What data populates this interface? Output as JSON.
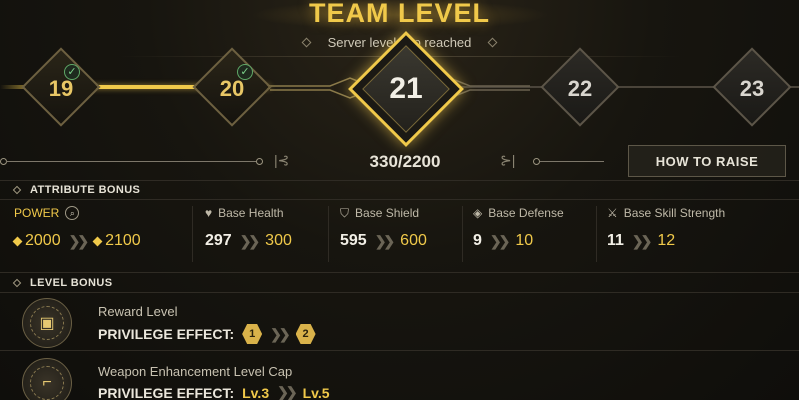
{
  "header": {
    "title": "TEAM LEVEL",
    "subtitle": "Server level cap reached"
  },
  "levels": {
    "nodes": [
      {
        "label": "19",
        "state": "completed"
      },
      {
        "label": "20",
        "state": "completed"
      },
      {
        "label": "21",
        "state": "current"
      },
      {
        "label": "22",
        "state": "locked"
      },
      {
        "label": "23",
        "state": "locked"
      }
    ],
    "check_icon": "checkmark-icon"
  },
  "progress": {
    "text": "330/2200",
    "current": 330,
    "max": 2200,
    "how_to_raise_label": "HOW TO RAISE"
  },
  "attribute_bonus": {
    "header": "ATTRIBUTE BONUS",
    "items": [
      {
        "name": "POWER",
        "icon": "search-icon",
        "from": "2000",
        "to": "2100",
        "highlight": true
      },
      {
        "name": "Base Health",
        "icon": "heart-icon",
        "from": "297",
        "to": "300"
      },
      {
        "name": "Base Shield",
        "icon": "shield-icon",
        "from": "595",
        "to": "600"
      },
      {
        "name": "Base Defense",
        "icon": "defense-icon",
        "from": "9",
        "to": "10"
      },
      {
        "name": "Base Skill Strength",
        "icon": "crossed-swords-icon",
        "from": "11",
        "to": "12"
      }
    ]
  },
  "level_bonus": {
    "header": "LEVEL BONUS",
    "items": [
      {
        "name": "Reward Level",
        "effect_label": "PRIVILEGE EFFECT:",
        "from": "1",
        "to": "2",
        "icon": "reward-chest-icon"
      },
      {
        "name": "Weapon Enhancement Level Cap",
        "effect_label": "PRIVILEGE EFFECT:",
        "from": "Lv.3",
        "to": "Lv.5",
        "icon": "pistol-icon"
      }
    ]
  },
  "colors": {
    "accent_gold": "#f0c94a",
    "background": "#17150f",
    "check_green": "#7cd08a"
  }
}
